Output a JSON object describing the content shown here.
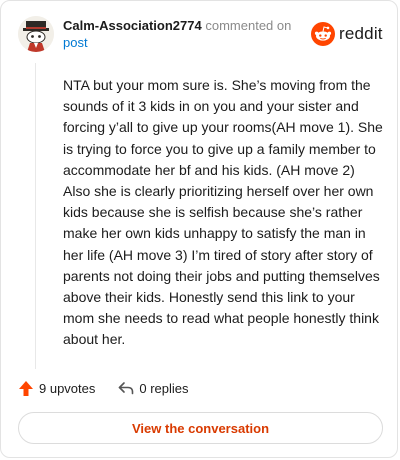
{
  "header": {
    "username": "Calm-Association2774",
    "commented_on": "commented on",
    "post_link": "post"
  },
  "brand": {
    "name": "reddit",
    "icon": "reddit-snoo-icon",
    "color": "#ff4500"
  },
  "comment": {
    "body": "NTA but your mom sure is. She’s moving from the sounds of it 3 kids in on you and your sister and forcing y’all to give up your rooms(AH move 1). She is trying to force you to give up a family member to accommodate her bf and his kids. (AH move 2) Also she is clearly prioritizing herself over her own kids because she is selfish because she’s rather make her own kids unhappy to satisfy the man in her life (AH move 3) I’m tired of story after story of parents not doing their jobs and putting themselves above their kids. Honestly send this link to your mom she needs to read what people honestly think about her."
  },
  "actions": {
    "upvotes": "9 upvotes",
    "upvote_icon": "upvote-arrow-icon",
    "upvote_color": "#ff4500",
    "replies": "0 replies",
    "reply_icon": "reply-arrow-icon"
  },
  "cta": {
    "label": "View the conversation",
    "color": "#d93a00"
  }
}
